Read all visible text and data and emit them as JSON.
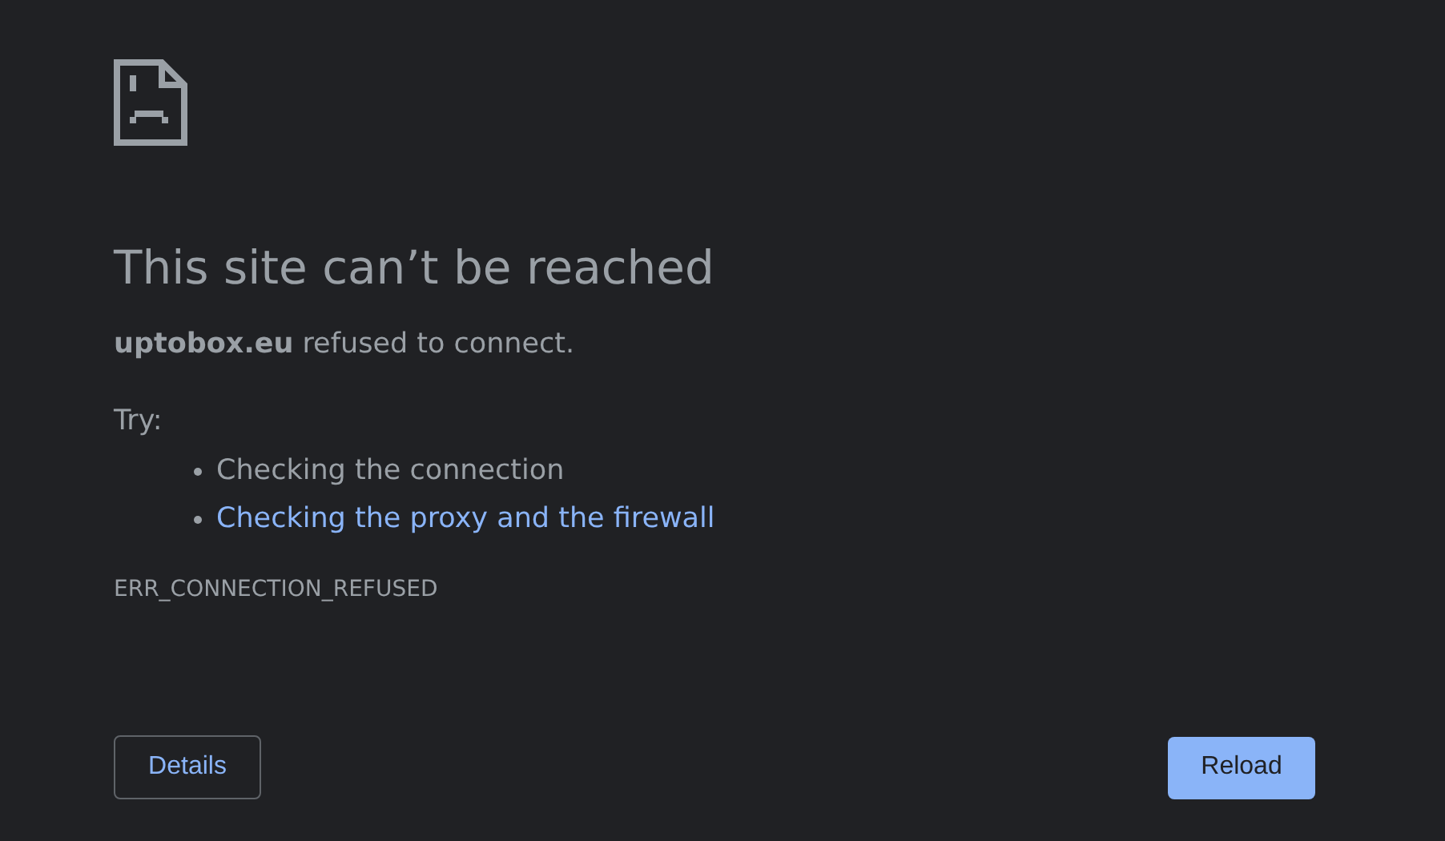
{
  "heading": "This site can’t be reached",
  "message": "**uptobox.eu** refused to connect.",
  "try_label": "Try:",
  "suggestions": [
    {
      "kind": "text",
      "text": "Checking the connection"
    },
    {
      "kind": "link",
      "text": "Checking the proxy and the firewall"
    }
  ],
  "error_code": "ERR_CONNECTION_REFUSED",
  "buttons": {
    "details": "Details",
    "reload": "Reload"
  }
}
